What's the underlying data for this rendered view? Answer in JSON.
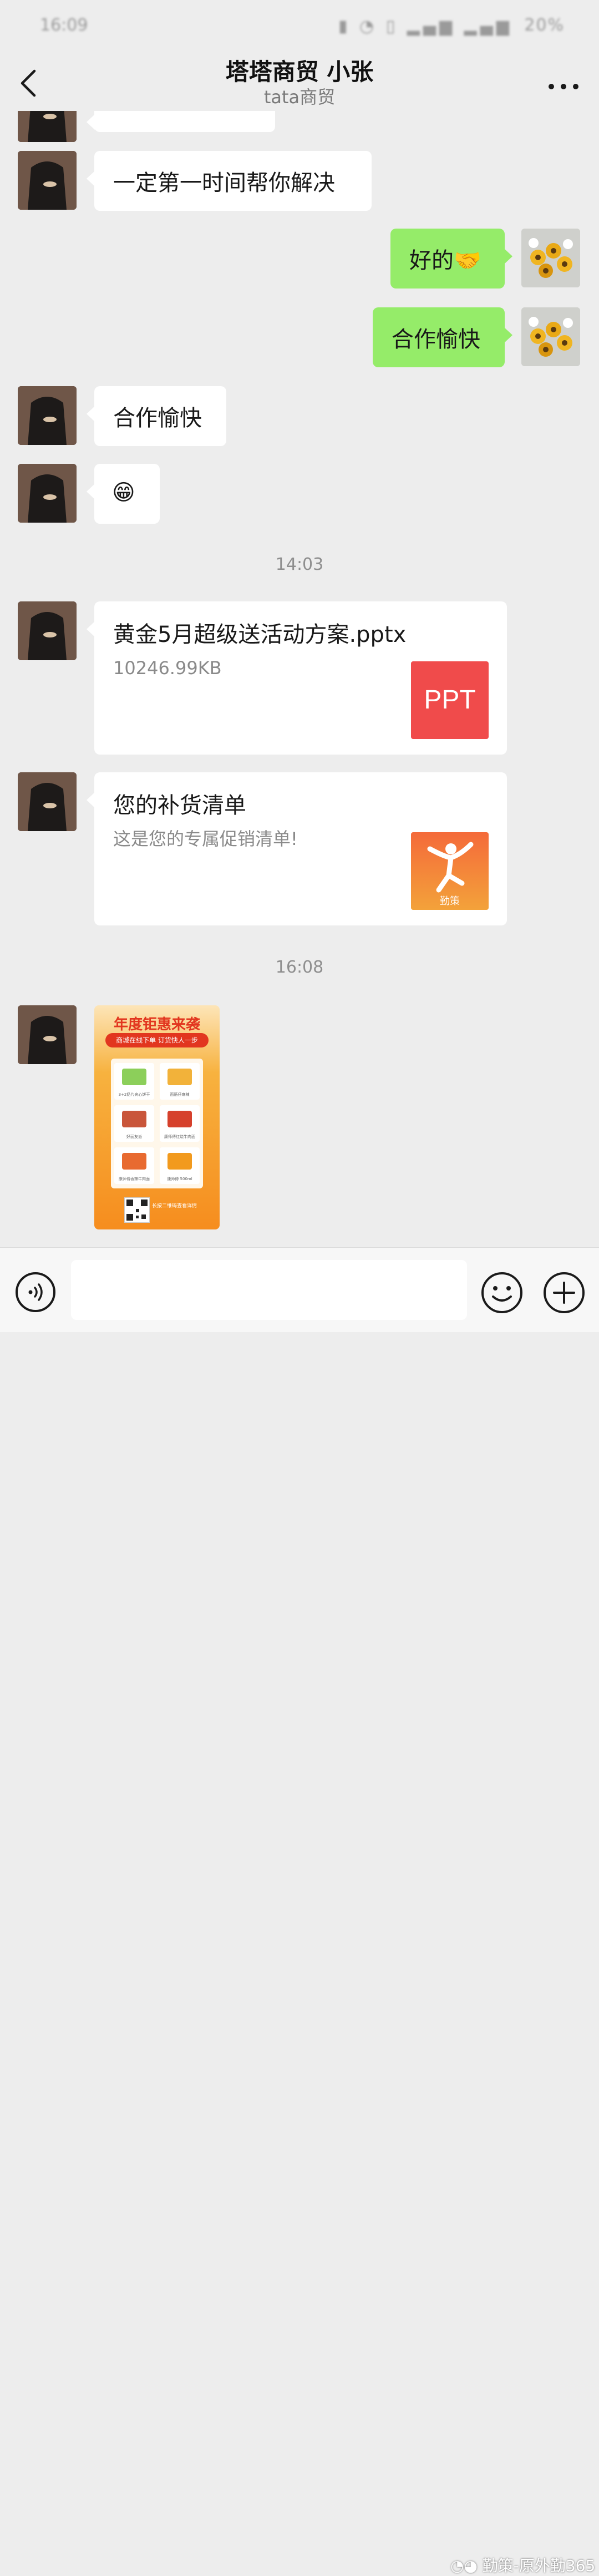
{
  "status_bar": {
    "time": "16:09",
    "battery": "20%"
  },
  "header": {
    "title": "塔塔商贸 小张",
    "subtitle": "tata商贸"
  },
  "messages": {
    "m1": "一定第一时间帮你解决",
    "m2": "好的🤝",
    "m3": "合作愉快",
    "m4": "合作愉快",
    "m5": "😁"
  },
  "time_1": "14:03",
  "file_card": {
    "name": "黄金5月超级送活动方案.pptx",
    "size": "10246.99KB",
    "badge": "PPT"
  },
  "link_card": {
    "title": "您的补货清单",
    "desc": "这是您的专属促销清单!",
    "app_label": "勤策"
  },
  "time_2": "16:08",
  "poster": {
    "title": "年度钜惠来袭",
    "banner": "商城在线下单 订货快人一步",
    "items": [
      "3+2奶片夹心饼干",
      "面筋仔麻辣",
      "好丽友派",
      "康师傅红烧牛肉面",
      "康师傅香辣牛肉面",
      "康师傅 500ml"
    ],
    "qr_note": "长按二维码查看详情"
  },
  "input": {
    "placeholder": ""
  },
  "watermark": "勤策-原外勤365",
  "colors": {
    "background": "#ededed",
    "bubble_green": "#95ec69",
    "ppt_red": "#f04b4b"
  }
}
